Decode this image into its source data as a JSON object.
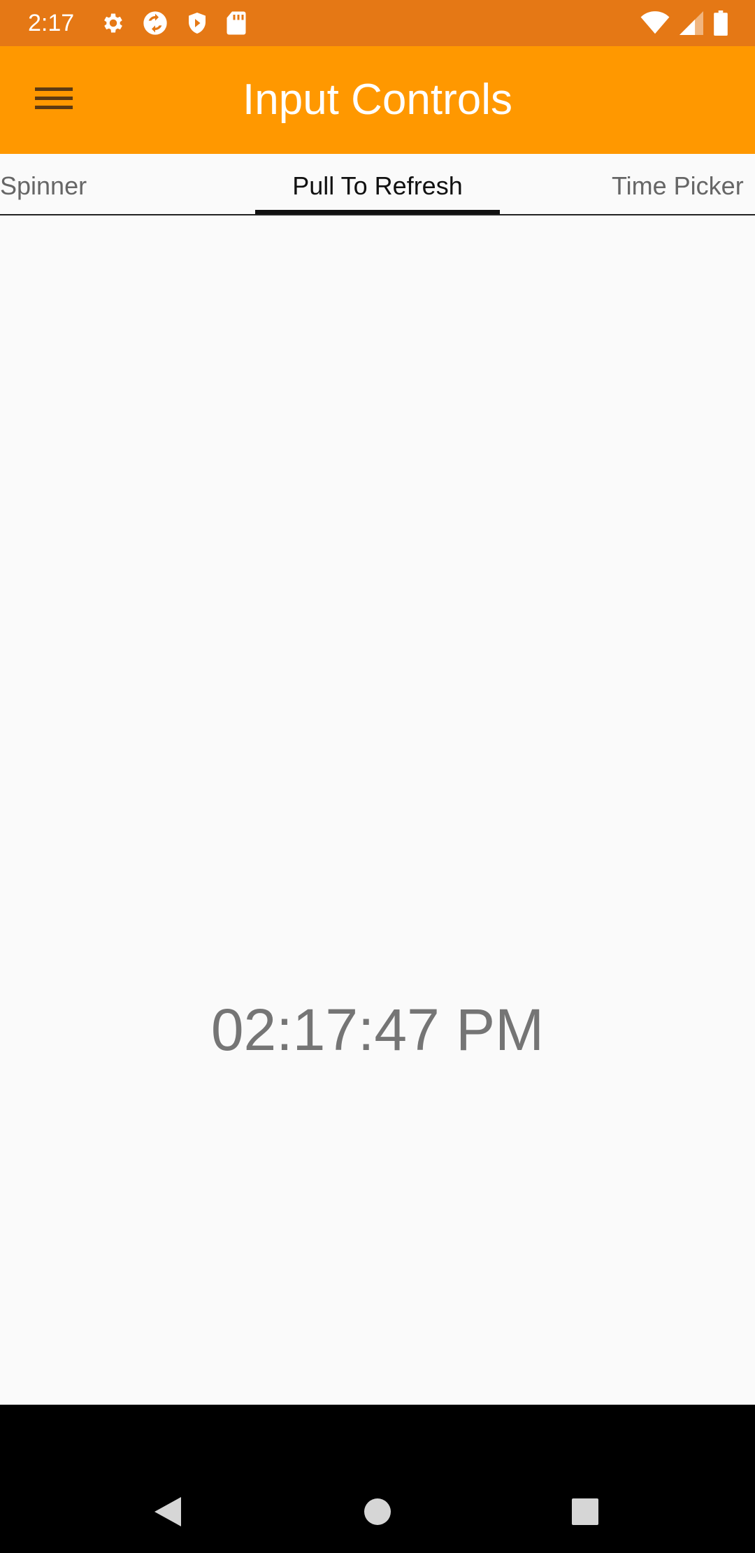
{
  "status_bar": {
    "time": "2:17",
    "left_icons": [
      "settings-icon",
      "sync-icon",
      "play-shield-icon",
      "sd-card-icon"
    ],
    "right_icons": [
      "wifi-icon",
      "cell-signal-icon",
      "battery-icon"
    ],
    "color": "#e57815"
  },
  "app_bar": {
    "title": "Input Controls",
    "menu_icon": "hamburger-menu-icon",
    "color": "#ff9800"
  },
  "tabs": [
    {
      "label": "Spinner",
      "selected": false
    },
    {
      "label": "Pull To Refresh",
      "selected": true
    },
    {
      "label": "Time Picker",
      "selected": false
    }
  ],
  "content": {
    "clock": "02:17:47 PM"
  },
  "nav_bar": {
    "buttons": [
      "back-icon",
      "home-icon",
      "recents-icon"
    ]
  }
}
